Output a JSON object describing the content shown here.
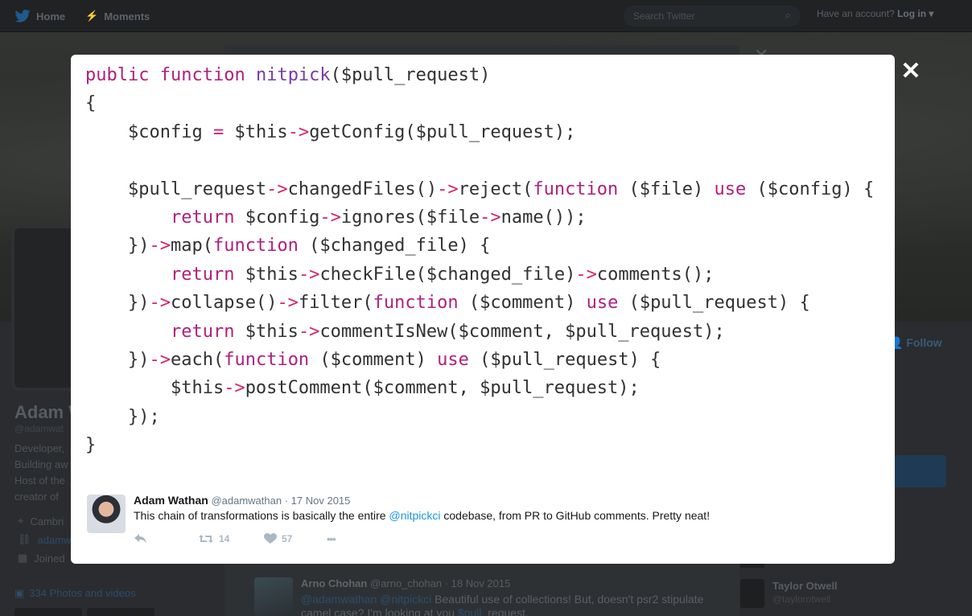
{
  "nav": {
    "home_label": "Home",
    "moments_label": "Moments",
    "search_placeholder": "Search Twitter",
    "have_account": "Have an account?",
    "login_label": "Log in"
  },
  "profile": {
    "name": "Adam W",
    "handle": "@adamwat",
    "bio": [
      "Developer,",
      "Building aw",
      "Host of the",
      "creator of"
    ],
    "location": "Cambri",
    "website": "adamw",
    "joined": "Joined",
    "photos_label": "334 Photos and videos",
    "follow_label": "Follow"
  },
  "tweet": {
    "author_name": "Adam Wathan",
    "author_handle": "@adamwathan",
    "date": "· 17 Nov 2015",
    "text_before": "This chain of transformations is basically the entire ",
    "mention": "@nitpickci",
    "text_after": " codebase, from PR to GitHub comments. Pretty neat!",
    "retweets": "14",
    "likes": "57",
    "more": "•••"
  },
  "reply": {
    "author_name": "Arno Chohan",
    "author_handle": "@arno_chohan",
    "date": "· 18 Nov 2015",
    "mention1": "@adamwathan",
    "mention2": "@nitpickci",
    "text": " Beautiful use of collections! But, doesn't psr2 stipulate",
    "text2_before": "camel case? I'm looking at you ",
    "text2_mention": "$pull",
    "text2_after": "_request."
  },
  "suggestion": {
    "name": "Taylor Otwell",
    "handle": "@taylorotwell"
  },
  "code": {
    "l1": {
      "kw1": "public",
      "kw2": "function",
      "fn": "nitpick",
      "rest": "($pull_request)"
    },
    "l2": "{",
    "l3": {
      "a": "    $config ",
      "op": "=",
      "b": " $this",
      "arrow": "->",
      "c": "getConfig($pull_request);"
    },
    "l5": {
      "a": "    $pull_request",
      "arrow1": "->",
      "b": "changedFiles()",
      "arrow2": "->",
      "c": "reject(",
      "kw": "function",
      "d": " ($file) ",
      "kw2": "use",
      "e": " ($config) {"
    },
    "l6": {
      "indent": "        ",
      "kw": "return",
      "a": " $config",
      "arrow1": "->",
      "b": "ignores($file",
      "arrow2": "->",
      "c": "name());"
    },
    "l7": {
      "a": "    })",
      "arrow": "->",
      "b": "map(",
      "kw": "function",
      "c": " ($changed_file) {"
    },
    "l8": {
      "indent": "        ",
      "kw": "return",
      "a": " $this",
      "arrow1": "->",
      "b": "checkFile($changed_file)",
      "arrow2": "->",
      "c": "comments();"
    },
    "l9": {
      "a": "    })",
      "arrow1": "->",
      "b": "collapse()",
      "arrow2": "->",
      "c": "filter(",
      "kw": "function",
      "d": " ($comment) ",
      "kw2": "use",
      "e": " ($pull_request) {"
    },
    "l10": {
      "indent": "        ",
      "kw": "return",
      "a": " $this",
      "arrow": "->",
      "b": "commentIsNew($comment, $pull_request);"
    },
    "l11": {
      "a": "    })",
      "arrow": "->",
      "b": "each(",
      "kw": "function",
      "c": " ($comment) ",
      "kw2": "use",
      "d": " ($pull_request) {"
    },
    "l12": {
      "a": "        $this",
      "arrow": "->",
      "b": "postComment($comment, $pull_request);"
    },
    "l13": "    });",
    "l14": "}"
  },
  "colors": {
    "keyword": "#b11f7a",
    "function_name": "#7a3aa8",
    "operator": "#d6236b",
    "link": "#1b95e0"
  }
}
